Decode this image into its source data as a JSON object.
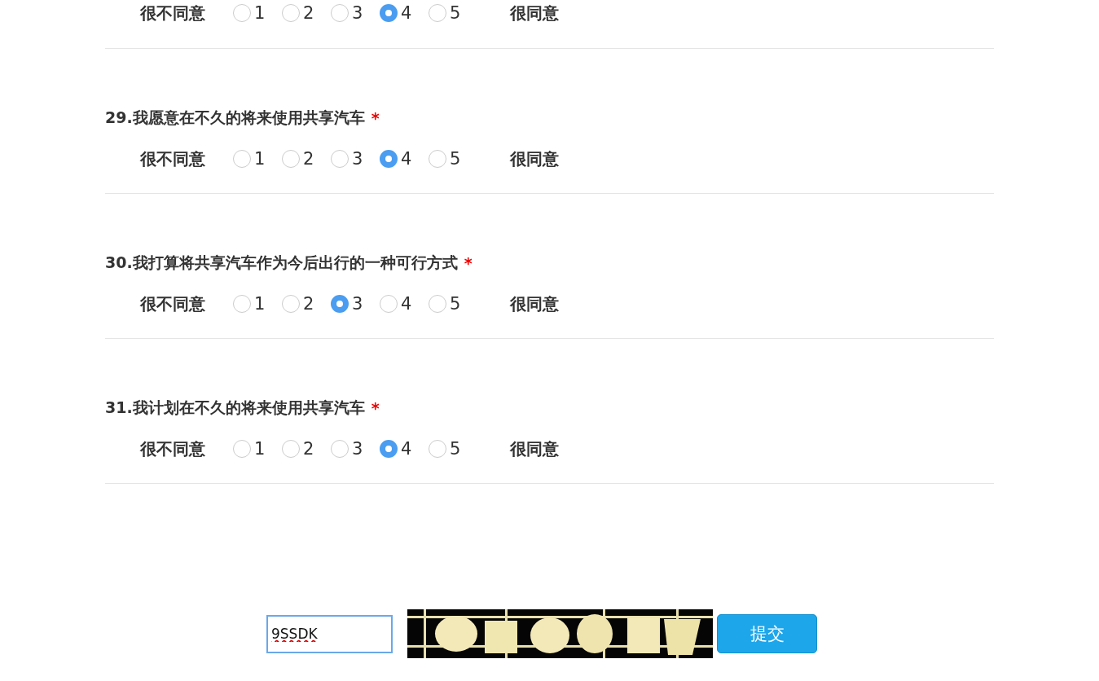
{
  "questions": [
    {
      "low_label": "很不同意",
      "high_label": "很同意",
      "options": [
        {
          "label": "1",
          "selected": false
        },
        {
          "label": "2",
          "selected": false
        },
        {
          "label": "3",
          "selected": false
        },
        {
          "label": "4",
          "selected": true
        },
        {
          "label": "5",
          "selected": false
        }
      ]
    },
    {
      "title": "29.我愿意在不久的将来使用共享汽车",
      "required_mark": "*",
      "low_label": "很不同意",
      "high_label": "很同意",
      "options": [
        {
          "label": "1",
          "selected": false
        },
        {
          "label": "2",
          "selected": false
        },
        {
          "label": "3",
          "selected": false
        },
        {
          "label": "4",
          "selected": true
        },
        {
          "label": "5",
          "selected": false
        }
      ]
    },
    {
      "title": "30.我打算将共享汽车作为今后出行的一种可行方式",
      "required_mark": "*",
      "low_label": "很不同意",
      "high_label": "很同意",
      "options": [
        {
          "label": "1",
          "selected": false
        },
        {
          "label": "2",
          "selected": false
        },
        {
          "label": "3",
          "selected": true
        },
        {
          "label": "4",
          "selected": false
        },
        {
          "label": "5",
          "selected": false
        }
      ]
    },
    {
      "title": "31.我计划在不久的将来使用共享汽车",
      "required_mark": "*",
      "low_label": "很不同意",
      "high_label": "很同意",
      "options": [
        {
          "label": "1",
          "selected": false
        },
        {
          "label": "2",
          "selected": false
        },
        {
          "label": "3",
          "selected": false
        },
        {
          "label": "4",
          "selected": true
        },
        {
          "label": "5",
          "selected": false
        }
      ]
    }
  ],
  "captcha": {
    "value": "9SSDK"
  },
  "submit_button": "提交"
}
